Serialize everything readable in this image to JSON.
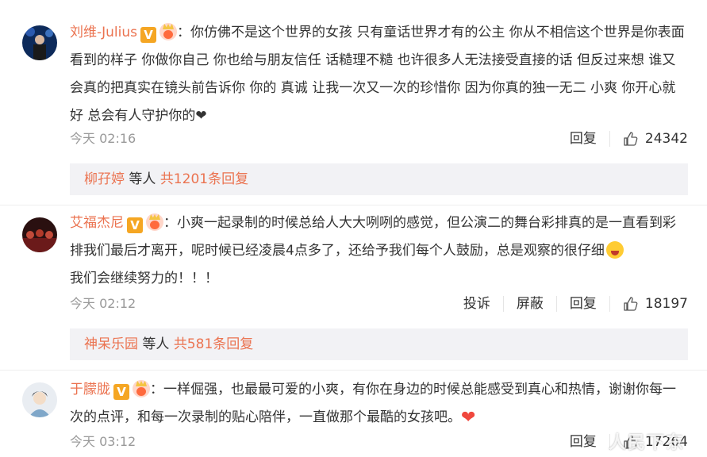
{
  "comments": [
    {
      "username": "刘维-Julius",
      "badge_v": "V",
      "text": "：你仿佛不是这个世界的女孩 只有童话世界才有的公主 你从不相信这个世界是你表面看到的样子 你做你自己 你也给与朋友信任 话糙理不糙 也许很多人无法接受直接的话 但反过来想 谁又会真的把真实在镜头前告诉你 你的 真诚 让我一次又一次的珍惜你 因为你真的独一无二 小爽 你开心就好 总会有人守护你的",
      "emoji": "❤",
      "time": "今天 02:16",
      "reply_label": "回复",
      "likes": "24342",
      "thread_user": "柳孖婷",
      "thread_mid": " 等人 ",
      "thread_count": "共1201条回复"
    },
    {
      "username": "艾福杰尼",
      "badge_v": "V",
      "text": "：小爽一起录制的时候总给人大大咧咧的感觉，但公演二的舞台彩排真的是一直看到彩排我们最后才离开，呢时候已经凌晨4点多了，还给予我们每个人鼓励，总是观察的很仔细",
      "text2": "我们会继续努力的！！！",
      "time": "今天 02:12",
      "report_label": "投诉",
      "block_label": "屏蔽",
      "reply_label": "回复",
      "likes": "18197",
      "thread_user": "神呆乐园",
      "thread_mid": " 等人 ",
      "thread_count": "共581条回复"
    },
    {
      "username": "于朦胧",
      "badge_v": "V",
      "text": "：一样倔强，也最最可爱的小爽，有你在身边的时候总能感受到真心和热情，谢谢你每一次的点评，和每一次录制的贴心陪伴，一直做那个最酷的女孩吧。",
      "emoji": "❤",
      "time": "今天 03:12",
      "reply_label": "回复",
      "likes": "17264"
    }
  ],
  "watermark": "人民下东",
  "colors": {
    "username": "#eb7350",
    "meta": "#999999",
    "reply_bg": "#f2f2f5"
  }
}
